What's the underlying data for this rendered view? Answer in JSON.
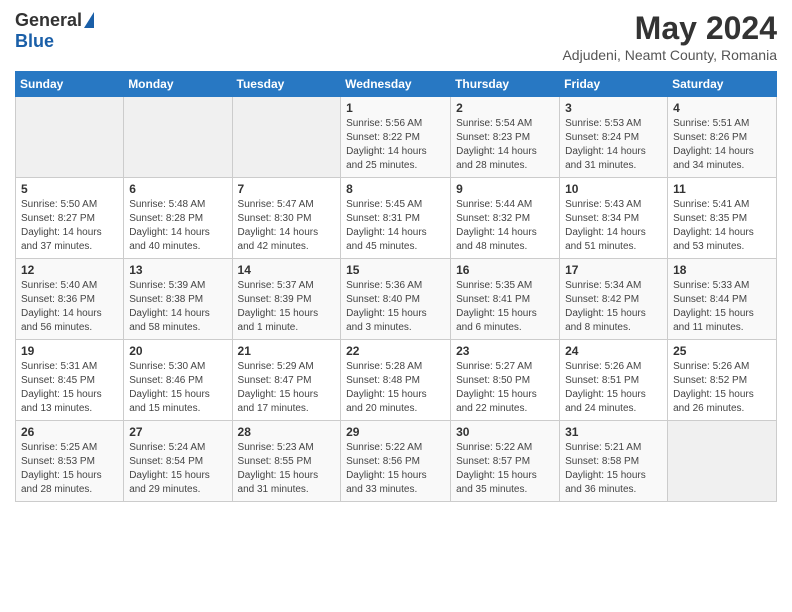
{
  "header": {
    "logo_general": "General",
    "logo_blue": "Blue",
    "month_year": "May 2024",
    "location": "Adjudeni, Neamt County, Romania"
  },
  "days_of_week": [
    "Sunday",
    "Monday",
    "Tuesday",
    "Wednesday",
    "Thursday",
    "Friday",
    "Saturday"
  ],
  "weeks": [
    [
      {
        "day": "",
        "info": ""
      },
      {
        "day": "",
        "info": ""
      },
      {
        "day": "",
        "info": ""
      },
      {
        "day": "1",
        "info": "Sunrise: 5:56 AM\nSunset: 8:22 PM\nDaylight: 14 hours and 25 minutes."
      },
      {
        "day": "2",
        "info": "Sunrise: 5:54 AM\nSunset: 8:23 PM\nDaylight: 14 hours and 28 minutes."
      },
      {
        "day": "3",
        "info": "Sunrise: 5:53 AM\nSunset: 8:24 PM\nDaylight: 14 hours and 31 minutes."
      },
      {
        "day": "4",
        "info": "Sunrise: 5:51 AM\nSunset: 8:26 PM\nDaylight: 14 hours and 34 minutes."
      }
    ],
    [
      {
        "day": "5",
        "info": "Sunrise: 5:50 AM\nSunset: 8:27 PM\nDaylight: 14 hours and 37 minutes."
      },
      {
        "day": "6",
        "info": "Sunrise: 5:48 AM\nSunset: 8:28 PM\nDaylight: 14 hours and 40 minutes."
      },
      {
        "day": "7",
        "info": "Sunrise: 5:47 AM\nSunset: 8:30 PM\nDaylight: 14 hours and 42 minutes."
      },
      {
        "day": "8",
        "info": "Sunrise: 5:45 AM\nSunset: 8:31 PM\nDaylight: 14 hours and 45 minutes."
      },
      {
        "day": "9",
        "info": "Sunrise: 5:44 AM\nSunset: 8:32 PM\nDaylight: 14 hours and 48 minutes."
      },
      {
        "day": "10",
        "info": "Sunrise: 5:43 AM\nSunset: 8:34 PM\nDaylight: 14 hours and 51 minutes."
      },
      {
        "day": "11",
        "info": "Sunrise: 5:41 AM\nSunset: 8:35 PM\nDaylight: 14 hours and 53 minutes."
      }
    ],
    [
      {
        "day": "12",
        "info": "Sunrise: 5:40 AM\nSunset: 8:36 PM\nDaylight: 14 hours and 56 minutes."
      },
      {
        "day": "13",
        "info": "Sunrise: 5:39 AM\nSunset: 8:38 PM\nDaylight: 14 hours and 58 minutes."
      },
      {
        "day": "14",
        "info": "Sunrise: 5:37 AM\nSunset: 8:39 PM\nDaylight: 15 hours and 1 minute."
      },
      {
        "day": "15",
        "info": "Sunrise: 5:36 AM\nSunset: 8:40 PM\nDaylight: 15 hours and 3 minutes."
      },
      {
        "day": "16",
        "info": "Sunrise: 5:35 AM\nSunset: 8:41 PM\nDaylight: 15 hours and 6 minutes."
      },
      {
        "day": "17",
        "info": "Sunrise: 5:34 AM\nSunset: 8:42 PM\nDaylight: 15 hours and 8 minutes."
      },
      {
        "day": "18",
        "info": "Sunrise: 5:33 AM\nSunset: 8:44 PM\nDaylight: 15 hours and 11 minutes."
      }
    ],
    [
      {
        "day": "19",
        "info": "Sunrise: 5:31 AM\nSunset: 8:45 PM\nDaylight: 15 hours and 13 minutes."
      },
      {
        "day": "20",
        "info": "Sunrise: 5:30 AM\nSunset: 8:46 PM\nDaylight: 15 hours and 15 minutes."
      },
      {
        "day": "21",
        "info": "Sunrise: 5:29 AM\nSunset: 8:47 PM\nDaylight: 15 hours and 17 minutes."
      },
      {
        "day": "22",
        "info": "Sunrise: 5:28 AM\nSunset: 8:48 PM\nDaylight: 15 hours and 20 minutes."
      },
      {
        "day": "23",
        "info": "Sunrise: 5:27 AM\nSunset: 8:50 PM\nDaylight: 15 hours and 22 minutes."
      },
      {
        "day": "24",
        "info": "Sunrise: 5:26 AM\nSunset: 8:51 PM\nDaylight: 15 hours and 24 minutes."
      },
      {
        "day": "25",
        "info": "Sunrise: 5:26 AM\nSunset: 8:52 PM\nDaylight: 15 hours and 26 minutes."
      }
    ],
    [
      {
        "day": "26",
        "info": "Sunrise: 5:25 AM\nSunset: 8:53 PM\nDaylight: 15 hours and 28 minutes."
      },
      {
        "day": "27",
        "info": "Sunrise: 5:24 AM\nSunset: 8:54 PM\nDaylight: 15 hours and 29 minutes."
      },
      {
        "day": "28",
        "info": "Sunrise: 5:23 AM\nSunset: 8:55 PM\nDaylight: 15 hours and 31 minutes."
      },
      {
        "day": "29",
        "info": "Sunrise: 5:22 AM\nSunset: 8:56 PM\nDaylight: 15 hours and 33 minutes."
      },
      {
        "day": "30",
        "info": "Sunrise: 5:22 AM\nSunset: 8:57 PM\nDaylight: 15 hours and 35 minutes."
      },
      {
        "day": "31",
        "info": "Sunrise: 5:21 AM\nSunset: 8:58 PM\nDaylight: 15 hours and 36 minutes."
      },
      {
        "day": "",
        "info": ""
      }
    ]
  ]
}
